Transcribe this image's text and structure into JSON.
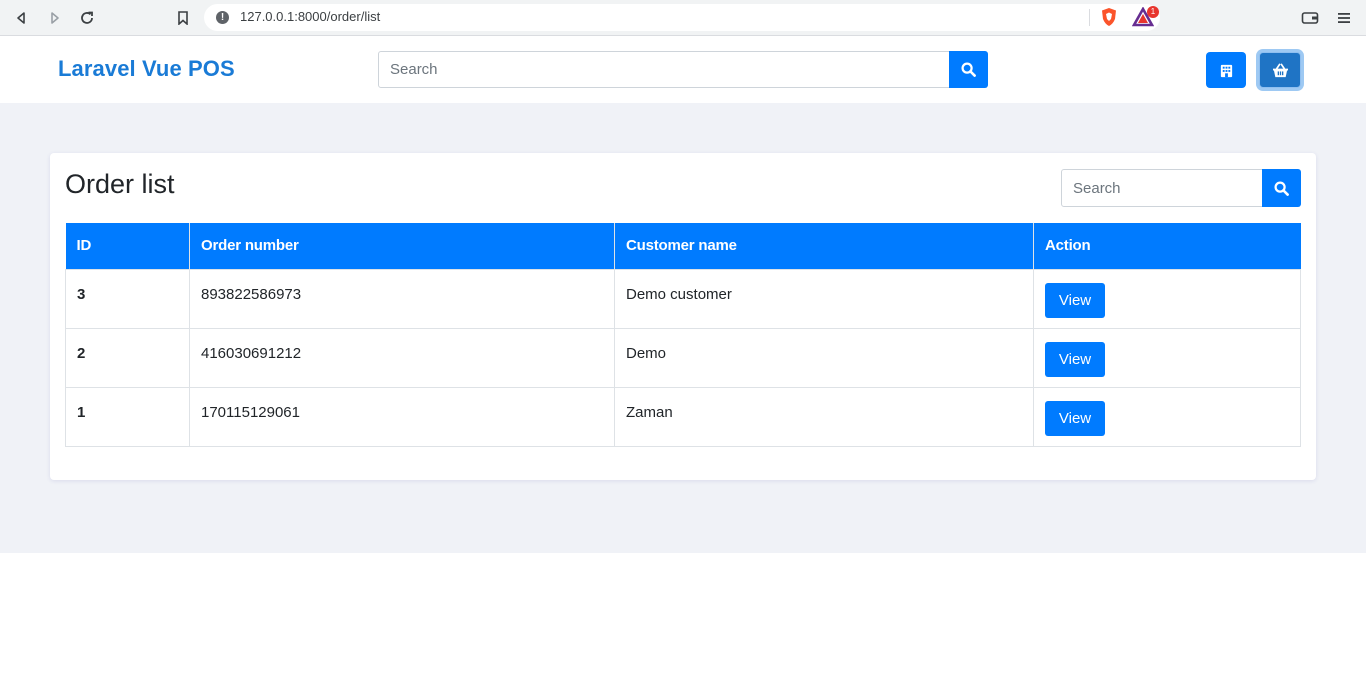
{
  "browser": {
    "url": "127.0.0.1:8000/order/list",
    "rewards_badge": "1"
  },
  "app": {
    "brand": "Laravel Vue POS",
    "search_placeholder": "Search"
  },
  "card": {
    "title": "Order list",
    "search_placeholder": "Search",
    "columns": [
      "ID",
      "Order number",
      "Customer name",
      "Action"
    ],
    "rows": [
      {
        "id": "3",
        "order_number": "893822586973",
        "customer": "Demo customer",
        "action": "View"
      },
      {
        "id": "2",
        "order_number": "416030691212",
        "customer": "Demo",
        "action": "View"
      },
      {
        "id": "1",
        "order_number": "170115129061",
        "customer": "Zaman",
        "action": "View"
      }
    ]
  },
  "colors": {
    "primary": "#007bff",
    "brand": "#1a7bd6",
    "page_bg": "#f0f2f7"
  }
}
